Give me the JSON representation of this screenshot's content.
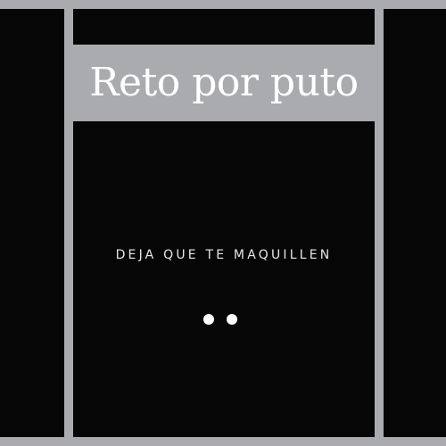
{
  "post": {
    "title": "Reto por puto",
    "subtitle": "DEJA QUE TE MAQUILLEN"
  },
  "carousel": {
    "indicator_count": 2
  },
  "colors": {
    "frame": "#a9abae",
    "panel": "#060606",
    "text": "#ffffff"
  }
}
